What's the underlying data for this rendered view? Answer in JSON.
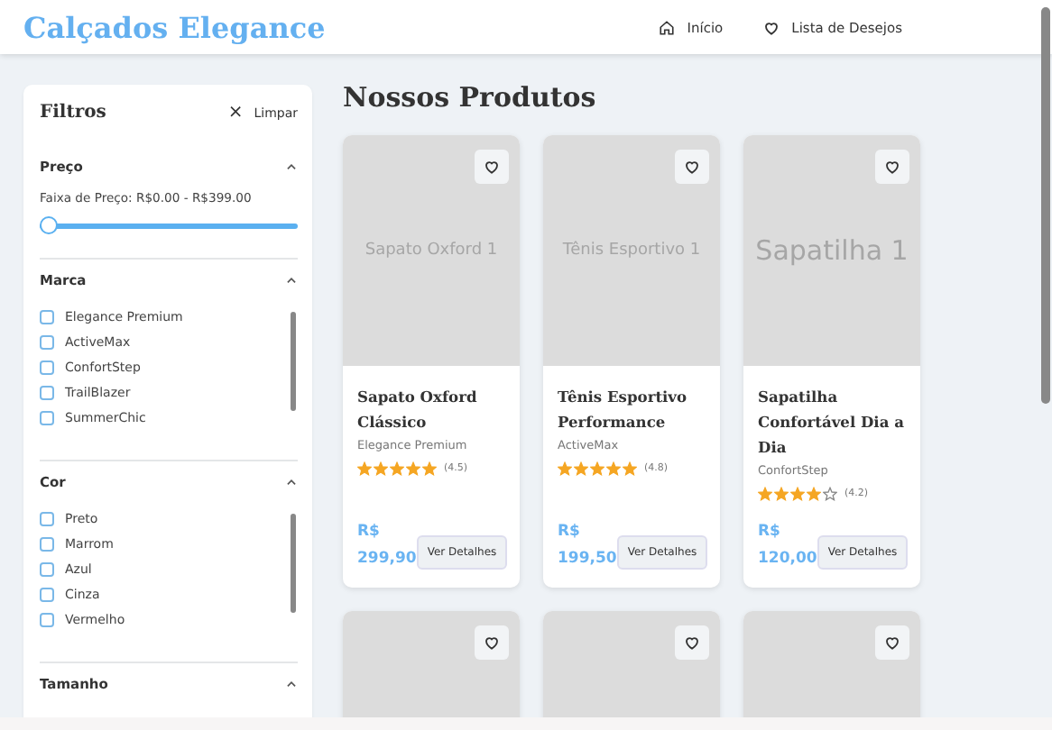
{
  "header": {
    "logo": "Calçados Elegance",
    "nav": [
      {
        "label": "Início"
      },
      {
        "label": "Lista de Desejos"
      }
    ]
  },
  "filters": {
    "title": "Filtros",
    "clear_icon": "×",
    "clear": "Limpar",
    "sections": [
      {
        "kind": "range",
        "title": "Preço",
        "expanded": true,
        "label": "Faixa de Preço: R$0.00 - R$399.00",
        "level": 0
      },
      {
        "kind": "checklist",
        "title": "Marca",
        "expanded": true,
        "options": [
          {
            "label": "Elegance Premium",
            "checked": false
          },
          {
            "label": "ActiveMax",
            "checked": false
          },
          {
            "label": "ConfortStep",
            "checked": false
          },
          {
            "label": "TrailBlazer",
            "checked": false
          },
          {
            "label": "SummerChic",
            "checked": false
          }
        ]
      },
      {
        "kind": "checklist",
        "title": "Cor",
        "expanded": true,
        "options": [
          {
            "label": "Preto",
            "checked": false
          },
          {
            "label": "Marrom",
            "checked": false
          },
          {
            "label": "Azul",
            "checked": false
          },
          {
            "label": "Cinza",
            "checked": false
          },
          {
            "label": "Vermelho",
            "checked": false
          }
        ]
      },
      {
        "kind": "header",
        "title": "Tamanho",
        "expanded": true
      }
    ]
  },
  "main": {
    "title": "Nossos Produtos",
    "products": [
      {
        "image_text": "Sapato Oxford 1",
        "name": "Sapato Oxford Clássico",
        "brand": "Elegance Premium",
        "stars": 5,
        "rating": "(4.5)",
        "currency": "R$",
        "price": "299,90",
        "button": "Ver Detalhes",
        "favorite": false
      },
      {
        "image_text": "Tênis Esportivo 1",
        "name": "Tênis Esportivo Performance",
        "brand": "ActiveMax",
        "stars": 5,
        "rating": "(4.8)",
        "currency": "R$",
        "price": "199,50",
        "button": "Ver Detalhes",
        "favorite": false
      },
      {
        "image_text": "Sapatilha 1",
        "kind": "large-label",
        "name": "Sapatilha Confortável Dia a Dia",
        "brand": "ConfortStep",
        "stars": 4,
        "rating": "(4.2)",
        "currency": "R$",
        "price": "120,00",
        "button": "Ver Detalhes",
        "favorite": false
      }
    ],
    "more_products": [
      {
        "favorite": false
      },
      {
        "favorite": false
      },
      {
        "favorite": false
      }
    ]
  }
}
